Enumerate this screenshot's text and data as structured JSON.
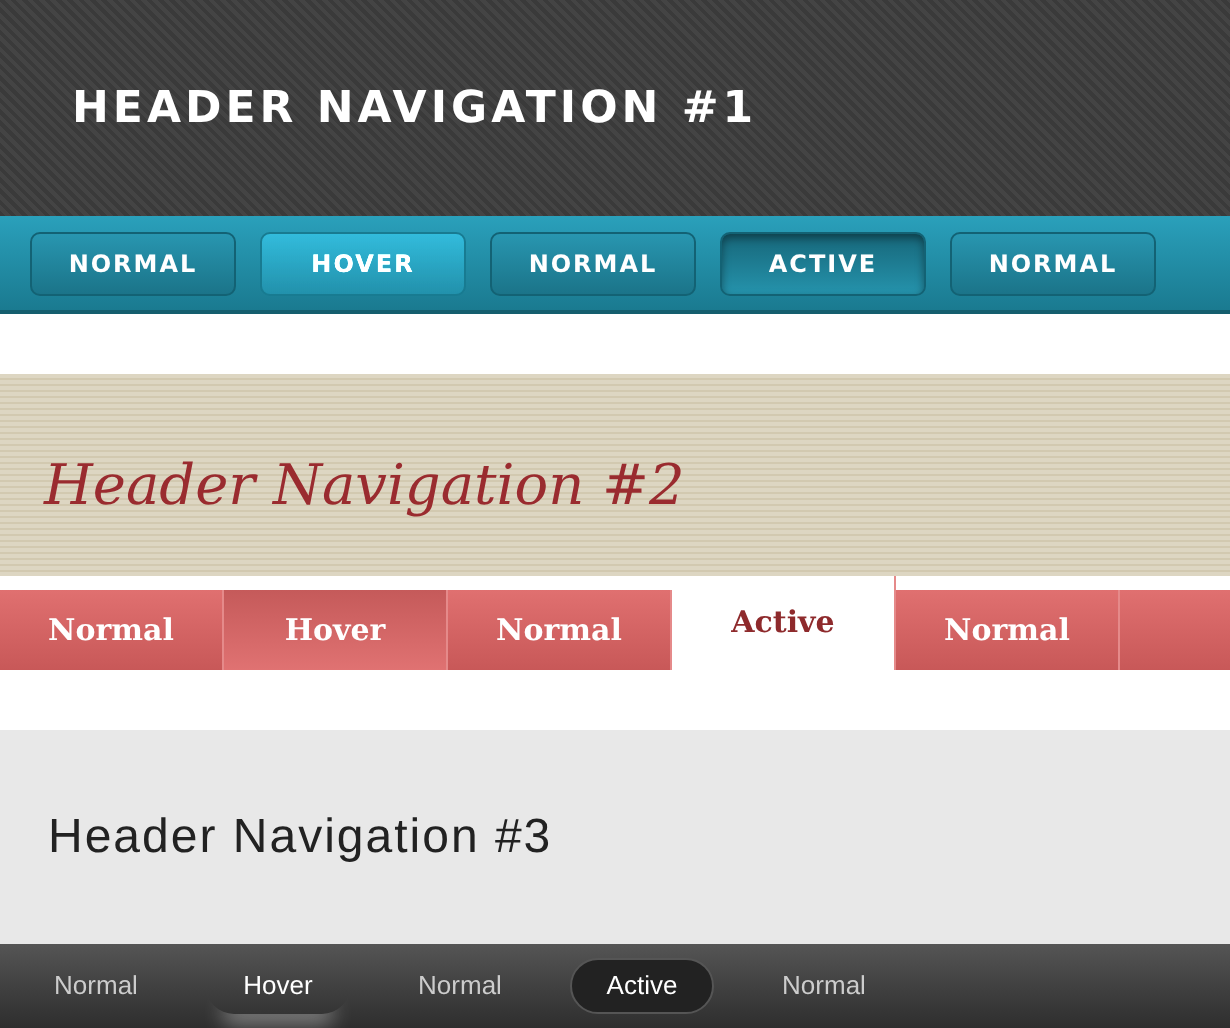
{
  "sections": [
    {
      "kind": "teal",
      "title": "HEADER NAVIGATION #1",
      "items": [
        {
          "label": "NORMAL",
          "hovered": false,
          "selected": false
        },
        {
          "label": "HOVER",
          "hovered": true,
          "selected": false
        },
        {
          "label": "NORMAL",
          "hovered": false,
          "selected": false
        },
        {
          "label": "ACTIVE",
          "hovered": false,
          "selected": true
        },
        {
          "label": "NORMAL",
          "hovered": false,
          "selected": false
        }
      ]
    },
    {
      "kind": "red",
      "title": "Header Navigation #2",
      "items": [
        {
          "label": "Normal",
          "hovered": false,
          "selected": false
        },
        {
          "label": "Hover",
          "hovered": true,
          "selected": false
        },
        {
          "label": "Normal",
          "hovered": false,
          "selected": false
        },
        {
          "label": "Active",
          "hovered": false,
          "selected": true
        },
        {
          "label": "Normal",
          "hovered": false,
          "selected": false
        }
      ]
    },
    {
      "kind": "dark",
      "title": "Header Navigation #3",
      "items": [
        {
          "label": "Normal",
          "hovered": false,
          "selected": false
        },
        {
          "label": "Hover",
          "hovered": true,
          "selected": false
        },
        {
          "label": "Normal",
          "hovered": false,
          "selected": false
        },
        {
          "label": "Active",
          "hovered": false,
          "selected": true
        },
        {
          "label": "Normal",
          "hovered": false,
          "selected": false
        }
      ]
    }
  ]
}
